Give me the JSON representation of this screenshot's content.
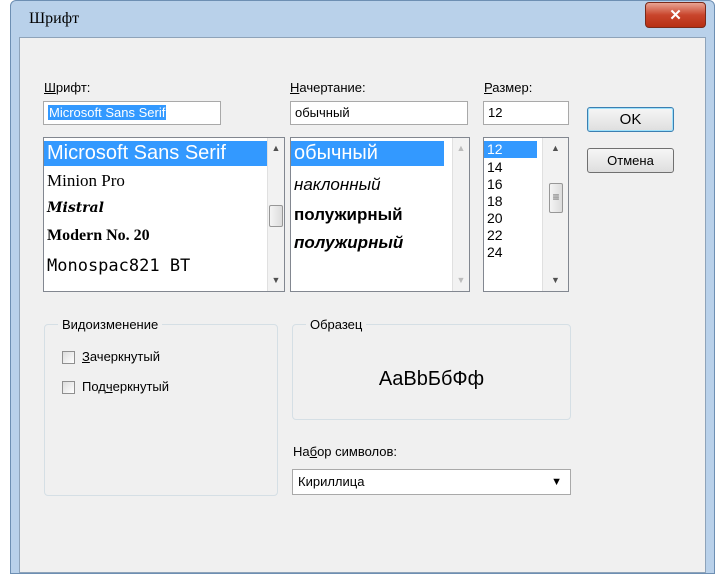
{
  "dialog": {
    "title": "Шрифт",
    "close_glyph": "✕"
  },
  "font": {
    "label_hotkey": "Ш",
    "label_rest": "рифт:",
    "value": "Microsoft Sans Serif",
    "items": [
      "Microsoft Sans Serif",
      "Minion Pro",
      "Mistral",
      "Modern No. 20",
      "Monospac821 BT"
    ]
  },
  "style": {
    "label_hotkey": "Н",
    "label_rest": "ачертание:",
    "value": "обычный",
    "items": [
      "обычный",
      "наклонный",
      "полужирный",
      "полужирный"
    ]
  },
  "size": {
    "label_hotkey": "Р",
    "label_rest": "азмер:",
    "value": "12",
    "items": [
      "12",
      "14",
      "16",
      "18",
      "20",
      "22",
      "24"
    ]
  },
  "buttons": {
    "ok": "OK",
    "cancel": "Отмена"
  },
  "effects": {
    "title": "Видоизменение",
    "strike_hotkey": "З",
    "strike_rest": "ачеркнутый",
    "underline_pre": "Под",
    "underline_hotkey": "ч",
    "underline_rest": "еркнутый"
  },
  "sample": {
    "title": "Образец",
    "text": "AaBbБбФф"
  },
  "charset": {
    "label_pre": "На",
    "label_hotkey": "б",
    "label_rest": "ор символов:",
    "value": "Кириллица"
  },
  "icons": {
    "scroll_up": "▲",
    "scroll_down": "▼",
    "dropdown": "▼",
    "grip": "≡"
  },
  "colors": {
    "selection": "#3399ff",
    "close_button": "#c9452c",
    "title_bar": "#b9d1ea"
  }
}
